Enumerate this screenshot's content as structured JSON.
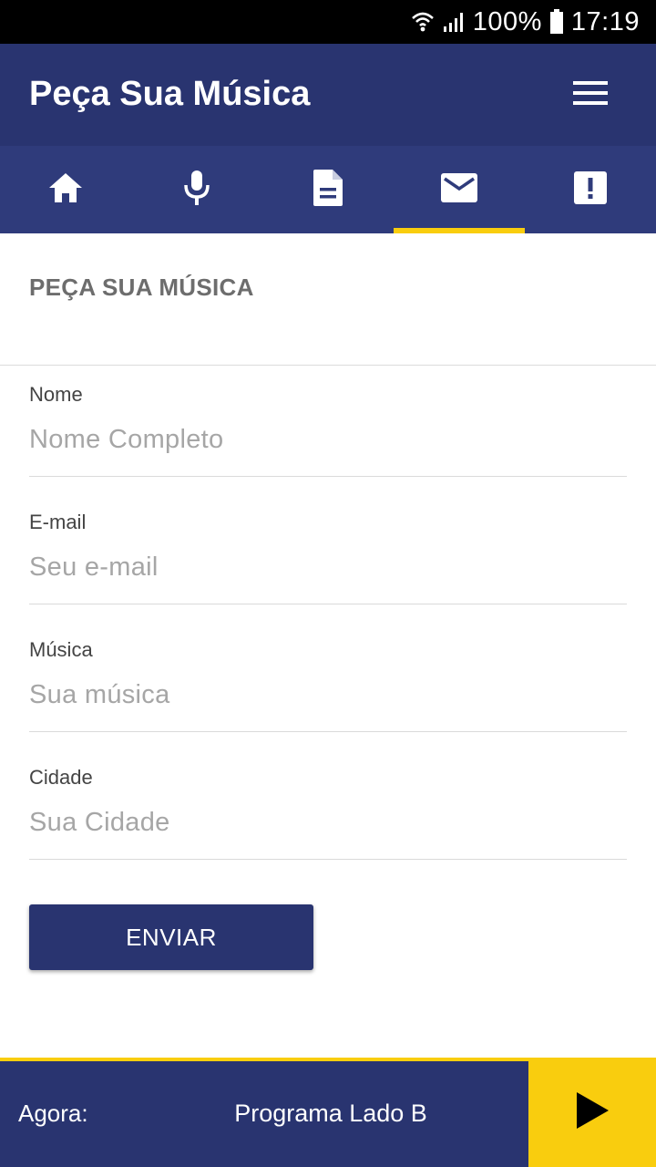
{
  "status_bar": {
    "battery": "100%",
    "time": "17:19",
    "icons": [
      "wifi-icon",
      "signal-icon",
      "battery-icon"
    ]
  },
  "app_bar": {
    "title": "Peça Sua Música",
    "menu_icon": "hamburger-menu-icon"
  },
  "tabs": [
    {
      "icon": "home-icon",
      "selected": false
    },
    {
      "icon": "microphone-icon",
      "selected": false
    },
    {
      "icon": "document-icon",
      "selected": false
    },
    {
      "icon": "mail-icon",
      "selected": true
    },
    {
      "icon": "alert-icon",
      "selected": false
    }
  ],
  "form": {
    "section_title": "PEÇA SUA MÚSICA",
    "fields": [
      {
        "label": "Nome",
        "placeholder": "Nome Completo",
        "value": ""
      },
      {
        "label": "E-mail",
        "placeholder": "Seu e-mail",
        "value": ""
      },
      {
        "label": "Música",
        "placeholder": "Sua música",
        "value": ""
      },
      {
        "label": "Cidade",
        "placeholder": "Sua Cidade",
        "value": ""
      }
    ],
    "submit_label": "ENVIAR"
  },
  "player": {
    "now_label": "Agora:",
    "program": "Programa Lado B",
    "play_icon": "play-icon"
  },
  "colors": {
    "primary": "#293470",
    "tab_bar": "#2f3b7b",
    "accent": "#f9cd0e",
    "status_bar": "#000000"
  }
}
